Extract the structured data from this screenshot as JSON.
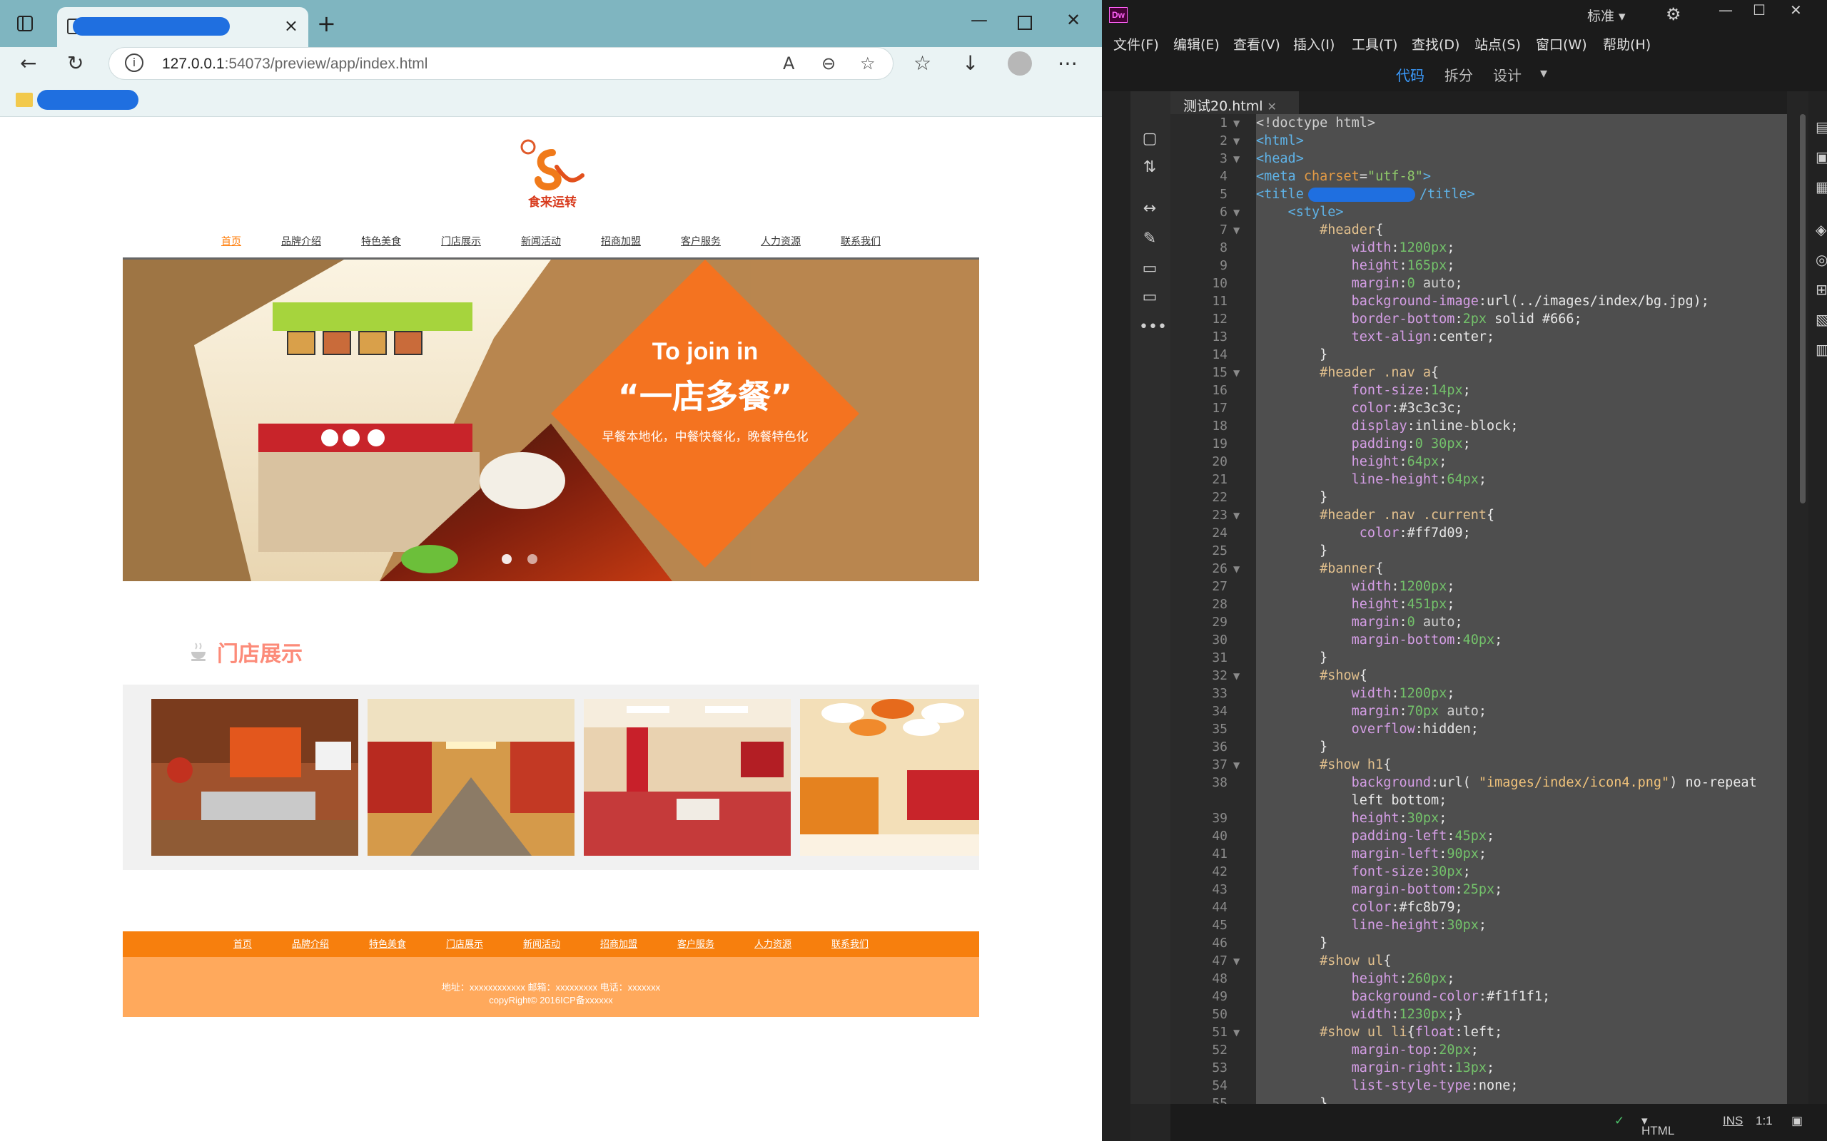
{
  "browser": {
    "address_host": "127.0.0.1",
    "address_rest": ":54073/preview/app/index.html",
    "new_tab": "+",
    "close_tab": "×"
  },
  "site": {
    "logo_text": "食来运转",
    "nav": [
      "首页",
      "品牌介绍",
      "特色美食",
      "门店展示",
      "新闻活动",
      "招商加盟",
      "客户服务",
      "人力资源",
      "联系我们"
    ],
    "banner": {
      "heading": "To join in",
      "subheading": "“一店多餐”",
      "tagline": "早餐本地化，中餐快餐化，晚餐特色化"
    },
    "show_title": "门店展示",
    "footer_nav": [
      "首页",
      "品牌介绍",
      "特色美食",
      "门店展示",
      "新闻活动",
      "招商加盟",
      "客户服务",
      "人力资源",
      "联系我们"
    ],
    "footer_line1": "地址：xxxxxxxxxxxx 邮箱：xxxxxxxxx 电话：xxxxxxx",
    "footer_line2": "copyRight© 2016ICP备xxxxxx"
  },
  "dw": {
    "logo": "Dw",
    "workspace": "标准",
    "menus": [
      "文件(F)",
      "编辑(E)",
      "查看(V)",
      "插入(I)",
      "工具(T)",
      "查找(D)",
      "站点(S)",
      "窗口(W)",
      "帮助(H)"
    ],
    "views": [
      "代码",
      "拆分",
      "设计"
    ],
    "file_tab": "测试20.html",
    "status_lang": "HTML",
    "status_mode": "INS",
    "status_pos": "1:1"
  }
}
